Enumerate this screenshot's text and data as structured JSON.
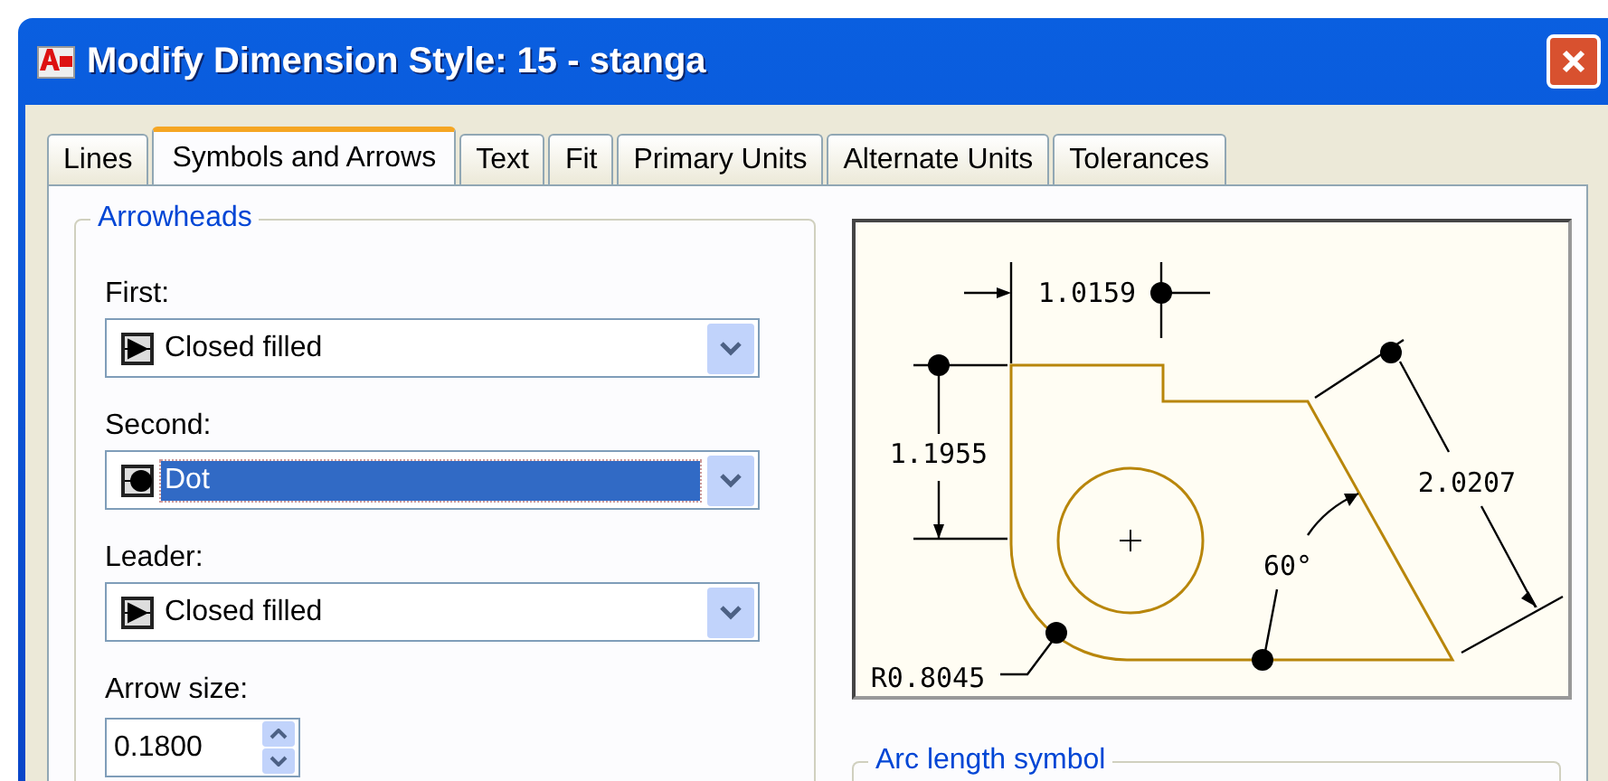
{
  "window": {
    "title": "Modify Dimension Style: 15 - stanga"
  },
  "tabs": [
    {
      "label": "Lines",
      "selected": false
    },
    {
      "label": "Symbols and Arrows",
      "selected": true
    },
    {
      "label": "Text",
      "selected": false
    },
    {
      "label": "Fit",
      "selected": false
    },
    {
      "label": "Primary Units",
      "selected": false
    },
    {
      "label": "Alternate Units",
      "selected": false
    },
    {
      "label": "Tolerances",
      "selected": false
    }
  ],
  "arrowheads": {
    "title": "Arrowheads",
    "fields": [
      {
        "label": "First:",
        "value": "Closed filled",
        "kind": "closed",
        "focused": false
      },
      {
        "label": "Second:",
        "value": "Dot",
        "kind": "dot",
        "focused": true
      },
      {
        "label": "Leader:",
        "value": "Closed filled",
        "kind": "closed",
        "focused": false
      }
    ]
  },
  "arrow_size": {
    "label": "Arrow size:",
    "value": "0.1800"
  },
  "preview": {
    "labels": [
      "1.0159",
      "1.1955",
      "2.0207",
      "60°",
      "R0.8045"
    ]
  },
  "arc_length": {
    "title": "Arc length symbol"
  }
}
